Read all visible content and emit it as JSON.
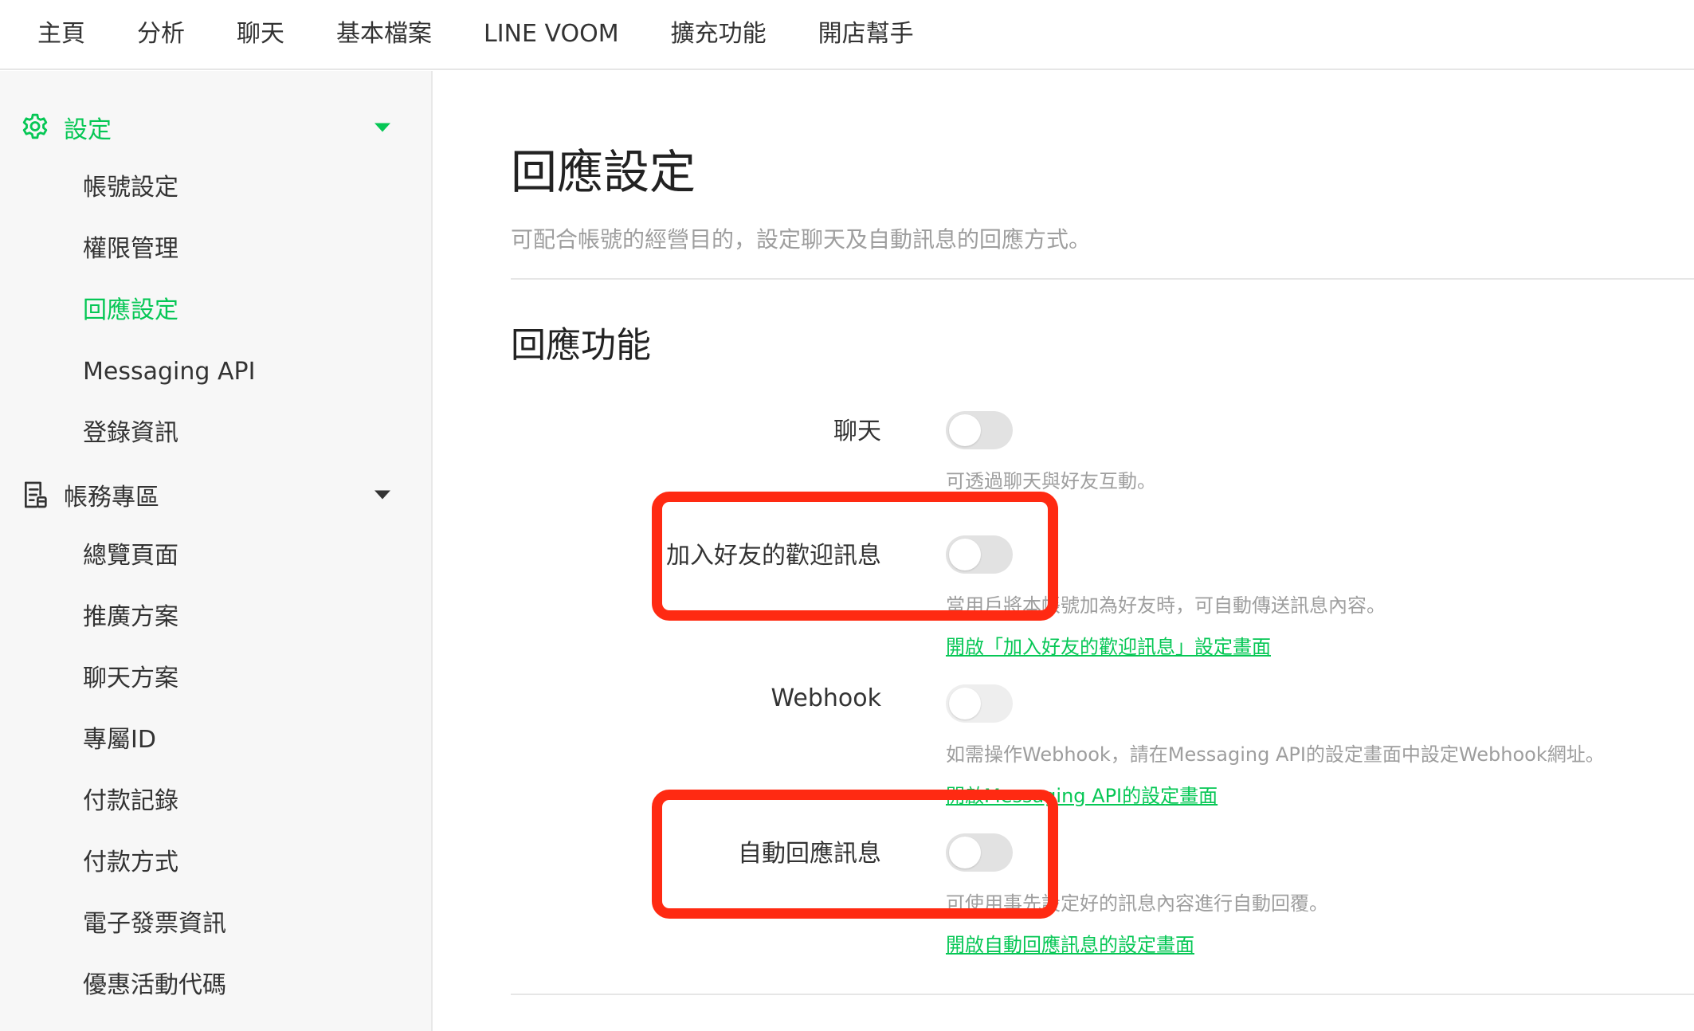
{
  "topnav": {
    "items": [
      "主頁",
      "分析",
      "聊天",
      "基本檔案",
      "LINE VOOM",
      "擴充功能",
      "開店幫手"
    ]
  },
  "sidebar": {
    "settings_group": {
      "label": "設定",
      "icon": "gear-icon",
      "color": "#06c755"
    },
    "settings_items": [
      "帳號設定",
      "權限管理",
      "回應設定",
      "Messaging API",
      "登錄資訊"
    ],
    "billing_group": {
      "label": "帳務專區",
      "icon": "document-icon"
    },
    "billing_items": [
      "總覽頁面",
      "推廣方案",
      "聊天方案",
      "專屬ID",
      "付款記錄",
      "付款方式",
      "電子發票資訊",
      "優惠活動代碼"
    ]
  },
  "main": {
    "title": "回應設定",
    "description": "可配合帳號的經營目的，設定聊天及自動訊息的回應方式。",
    "section_title": "回應功能",
    "rows": [
      {
        "label": "聊天",
        "enabled": false,
        "help": "可透過聊天與好友互動。",
        "link": ""
      },
      {
        "label": "加入好友的歡迎訊息",
        "enabled": false,
        "help": "當用戶將本帳號加為好友時，可自動傳送訊息內容。",
        "link": "開啟「加入好友的歡迎訊息」設定畫面"
      },
      {
        "label": "Webhook",
        "enabled": false,
        "help": "如需操作Webhook，請在Messaging API的設定畫面中設定Webhook網址。",
        "link": "開啟Messaging API的設定畫面"
      },
      {
        "label": "自動回應訊息",
        "enabled": false,
        "help": "可使用事先設定好的訊息內容進行自動回覆。",
        "link": "開啟自動回應訊息的設定畫面"
      }
    ]
  },
  "colors": {
    "accent": "#06c755",
    "highlight": "#ff2a12",
    "toggle_off": "#e2e2e2"
  }
}
